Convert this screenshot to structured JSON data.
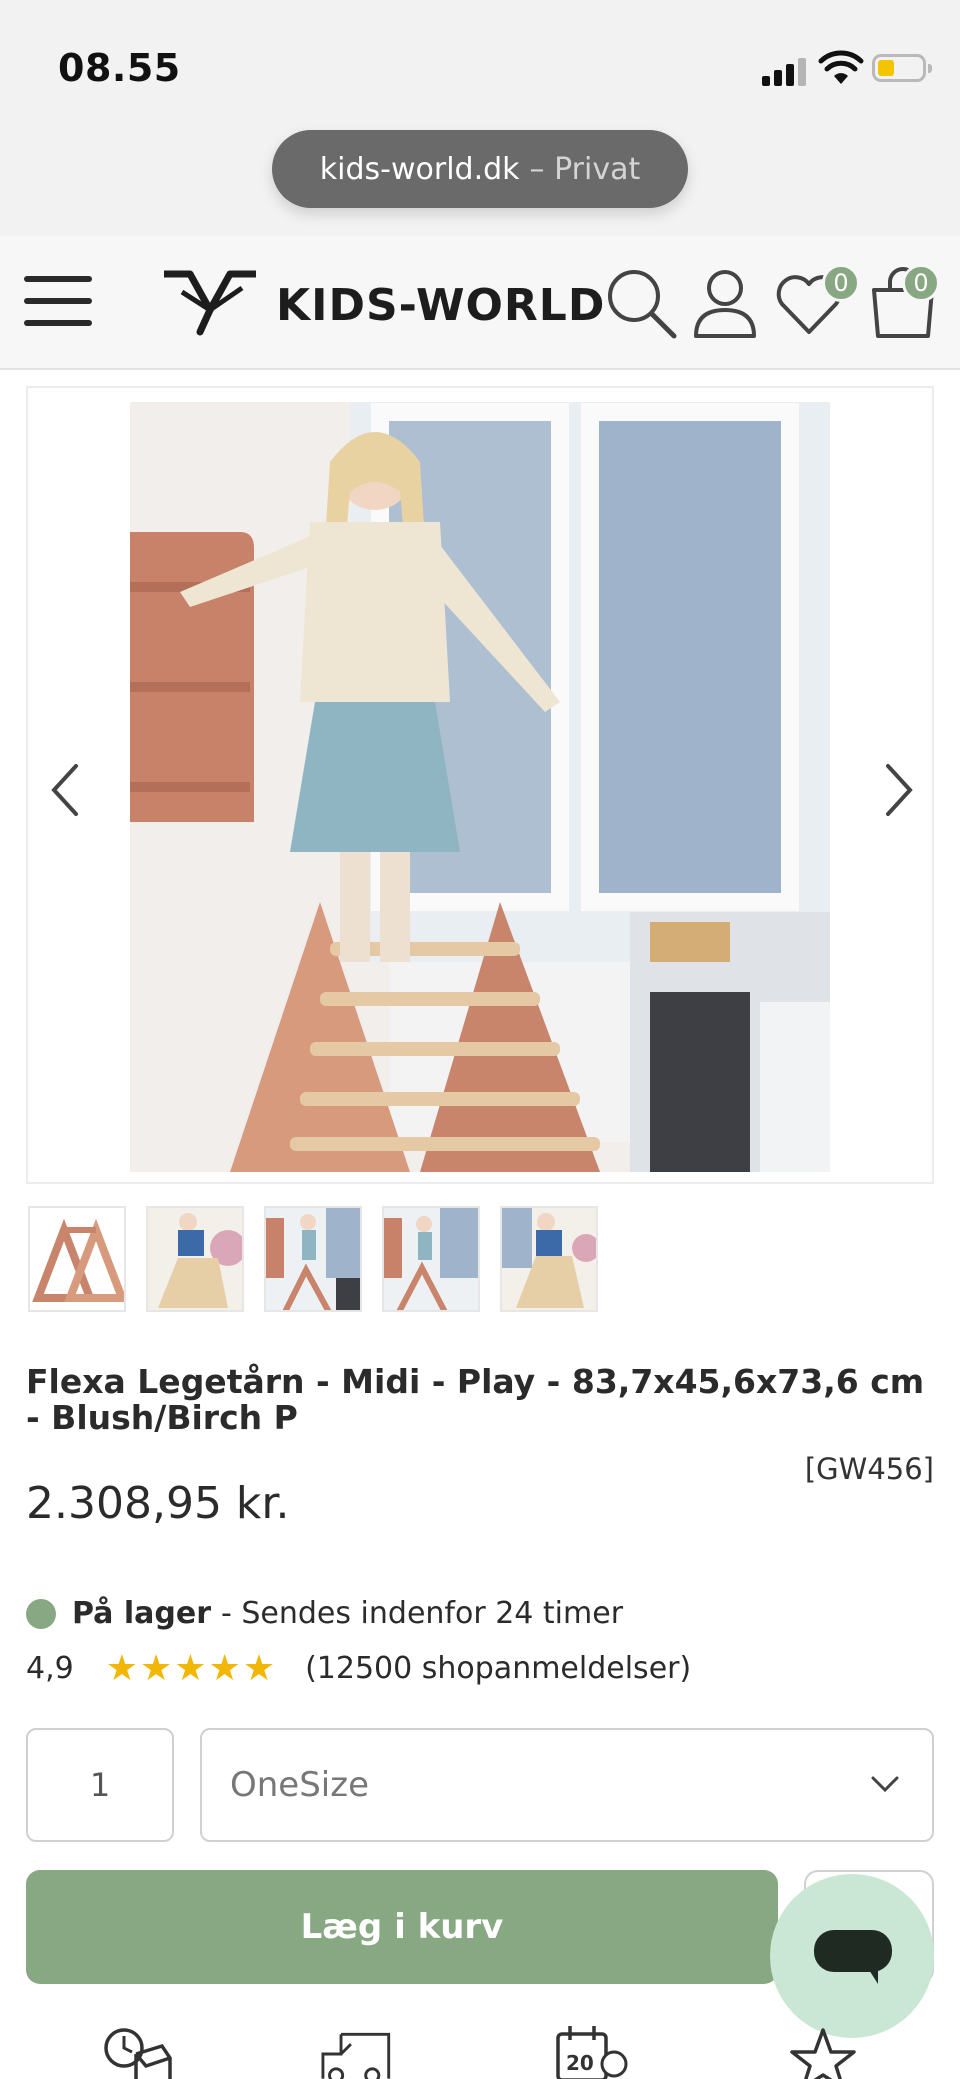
{
  "status_bar": {
    "time": "08.55",
    "battery_color": "#f5c400"
  },
  "browser": {
    "domain": "kids-world.dk",
    "mode": "– Privat"
  },
  "header": {
    "logo_text": "KIDS-WORLD",
    "wishlist_count": "0",
    "cart_count": "0",
    "accent_color": "#87a882",
    "icons": [
      "menu-icon",
      "search-icon",
      "user-icon",
      "heart-icon",
      "bag-icon"
    ]
  },
  "gallery": {
    "prev_icon": "chevron-left-icon",
    "next_icon": "chevron-right-icon",
    "thumbnail_count": 5
  },
  "product": {
    "title": "Flexa Legetårn - Midi - Play - 83,7x45,6x73,6 cm - Blush/Birch P",
    "sku": "[GW456]",
    "price": "2.308,95 kr.",
    "stock_label": "På lager",
    "stock_detail": "- Sendes indenfor 24 timer",
    "rating_value": "4,9",
    "stars": "★★★★★",
    "rating_count": "(12500 shopanmeldelser)"
  },
  "purchase": {
    "quantity": "1",
    "size": "OneSize",
    "add_to_cart": "Læg i kurv"
  },
  "bottom_icons": [
    "delivery-time-icon",
    "truck-icon",
    "calendar-20-icon",
    "star-icon"
  ]
}
